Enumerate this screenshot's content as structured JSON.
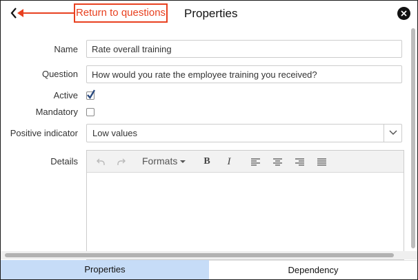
{
  "header": {
    "title": "Properties",
    "callout_text": "Return to questions",
    "back_icon": "chevron-left-icon",
    "close_icon": "close-icon",
    "callout_color": "#e8401f"
  },
  "form": {
    "name_label": "Name",
    "name_value": "Rate overall training",
    "question_label": "Question",
    "question_value": "How would you rate the employee training you received?",
    "active_label": "Active",
    "active_checked": true,
    "mandatory_label": "Mandatory",
    "mandatory_checked": false,
    "positive_indicator_label": "Positive indicator",
    "positive_indicator_value": "Low values",
    "details_label": "Details"
  },
  "editor": {
    "formats_label": "Formats",
    "toolbar_icons": [
      "undo-icon",
      "redo-icon",
      "bold-icon",
      "italic-icon",
      "align-left-icon",
      "align-center-icon",
      "align-right-icon",
      "align-justify-icon"
    ],
    "bold_glyph": "B",
    "italic_glyph": "I"
  },
  "tabs": [
    {
      "label": "Properties",
      "active": true
    },
    {
      "label": "Dependency",
      "active": false
    }
  ],
  "colors": {
    "active_tab": "#c6dcf7",
    "checkbox_checked": "#2a4a7f"
  }
}
